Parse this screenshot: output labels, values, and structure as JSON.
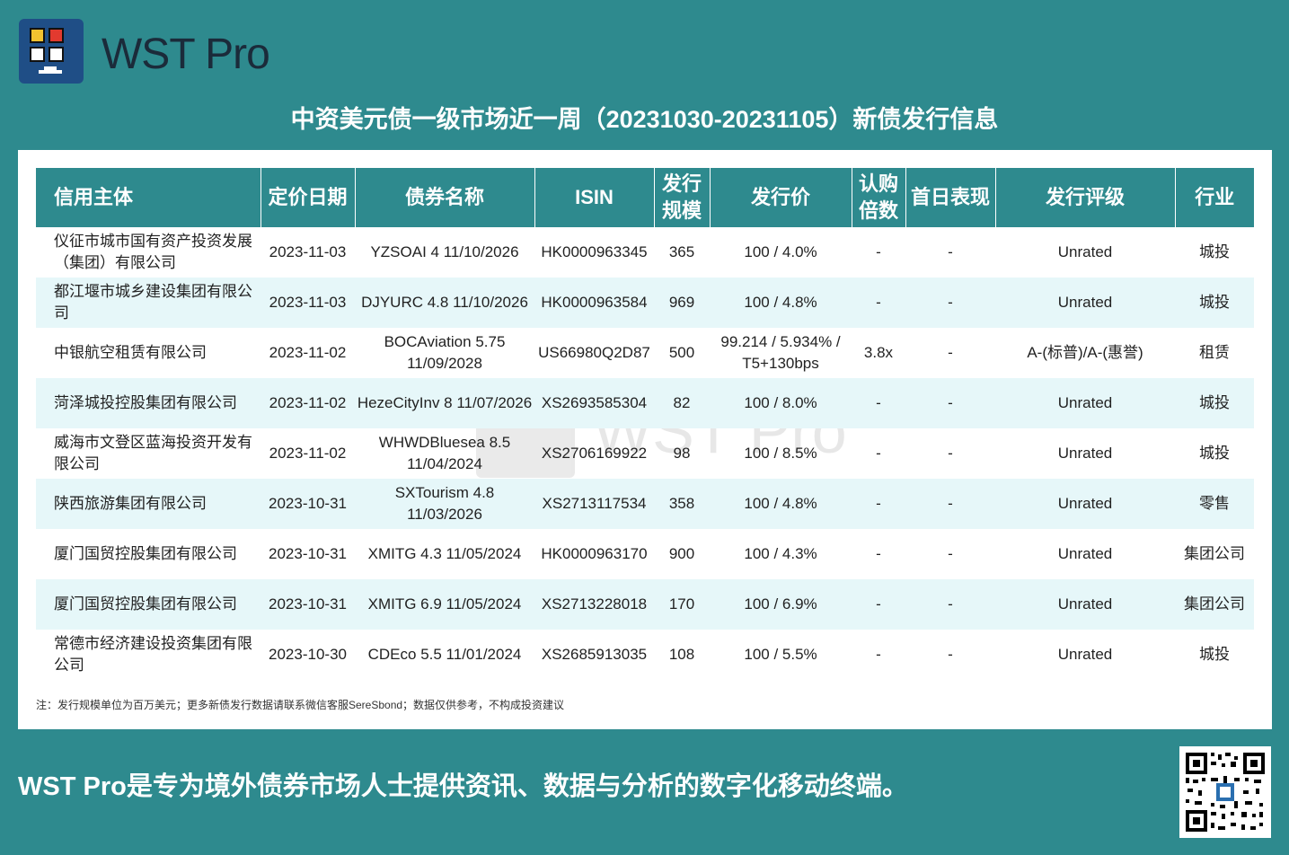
{
  "brand": {
    "name": "WST Pro"
  },
  "title": "中资美元债一级市场近一周（20231030-20231105）新债发行信息",
  "table": {
    "headers": {
      "issuer": "信用主体",
      "pricing_date": "定价日期",
      "bond_name": "债券名称",
      "isin": "ISIN",
      "size_1": "发行",
      "size_2": "规模",
      "price": "发行价",
      "sub_1": "认购",
      "sub_2": "倍数",
      "first_day": "首日表现",
      "rating": "发行评级",
      "industry": "行业"
    },
    "rows": [
      {
        "issuer": "仪征市城市国有资产投资发展（集团）有限公司",
        "date": "2023-11-03",
        "bond": "YZSOAI 4 11/10/2026",
        "isin": "HK0000963345",
        "size": "365",
        "price": "100 / 4.0%",
        "sub": "-",
        "first": "-",
        "rating": "Unrated",
        "industry": "城投"
      },
      {
        "issuer": "都江堰市城乡建设集团有限公司",
        "date": "2023-11-03",
        "bond": "DJYURC 4.8 11/10/2026",
        "isin": "HK0000963584",
        "size": "969",
        "price": "100 / 4.8%",
        "sub": "-",
        "first": "-",
        "rating": "Unrated",
        "industry": "城投"
      },
      {
        "issuer": "中银航空租赁有限公司",
        "date": "2023-11-02",
        "bond": "BOCAviation 5.75 11/09/2028",
        "isin": "US66980Q2D87",
        "size": "500",
        "price": "99.214 / 5.934% / T5+130bps",
        "sub": "3.8x",
        "first": "-",
        "rating": "A-(标普)/A-(惠誉)",
        "industry": "租赁"
      },
      {
        "issuer": "菏泽城投控股集团有限公司",
        "date": "2023-11-02",
        "bond": "HezeCityInv 8 11/07/2026",
        "isin": "XS2693585304",
        "size": "82",
        "price": "100 / 8.0%",
        "sub": "-",
        "first": "-",
        "rating": "Unrated",
        "industry": "城投"
      },
      {
        "issuer": "威海市文登区蓝海投资开发有限公司",
        "date": "2023-11-02",
        "bond": "WHWDBluesea 8.5 11/04/2024",
        "isin": "XS2706169922",
        "size": "98",
        "price": "100 / 8.5%",
        "sub": "-",
        "first": "-",
        "rating": "Unrated",
        "industry": "城投"
      },
      {
        "issuer": "陕西旅游集团有限公司",
        "date": "2023-10-31",
        "bond": "SXTourism 4.8 11/03/2026",
        "isin": "XS2713117534",
        "size": "358",
        "price": "100 / 4.8%",
        "sub": "-",
        "first": "-",
        "rating": "Unrated",
        "industry": "零售"
      },
      {
        "issuer": "厦门国贸控股集团有限公司",
        "date": "2023-10-31",
        "bond": "XMITG 4.3 11/05/2024",
        "isin": "HK0000963170",
        "size": "900",
        "price": "100 / 4.3%",
        "sub": "-",
        "first": "-",
        "rating": "Unrated",
        "industry": "集团公司"
      },
      {
        "issuer": "厦门国贸控股集团有限公司",
        "date": "2023-10-31",
        "bond": "XMITG 6.9 11/05/2024",
        "isin": "XS2713228018",
        "size": "170",
        "price": "100 / 6.9%",
        "sub": "-",
        "first": "-",
        "rating": "Unrated",
        "industry": "集团公司"
      },
      {
        "issuer": "常德市经济建设投资集团有限公司",
        "date": "2023-10-30",
        "bond": "CDEco 5.5 11/01/2024",
        "isin": "XS2685913035",
        "size": "108",
        "price": "100 / 5.5%",
        "sub": "-",
        "first": "-",
        "rating": "Unrated",
        "industry": "城投"
      }
    ]
  },
  "note": "注：发行规模单位为百万美元；更多新债发行数据请联系微信客服SereSbond；数据仅供参考，不构成投资建议",
  "slogan": "WST Pro是专为境外债券市场人士提供资讯、数据与分析的数字化移动终端。",
  "colors": {
    "background": "#2e8a8e",
    "header": "#2e8a8e",
    "row_alt": "#e6f7f9",
    "logo_bg": "#1f4e86"
  }
}
